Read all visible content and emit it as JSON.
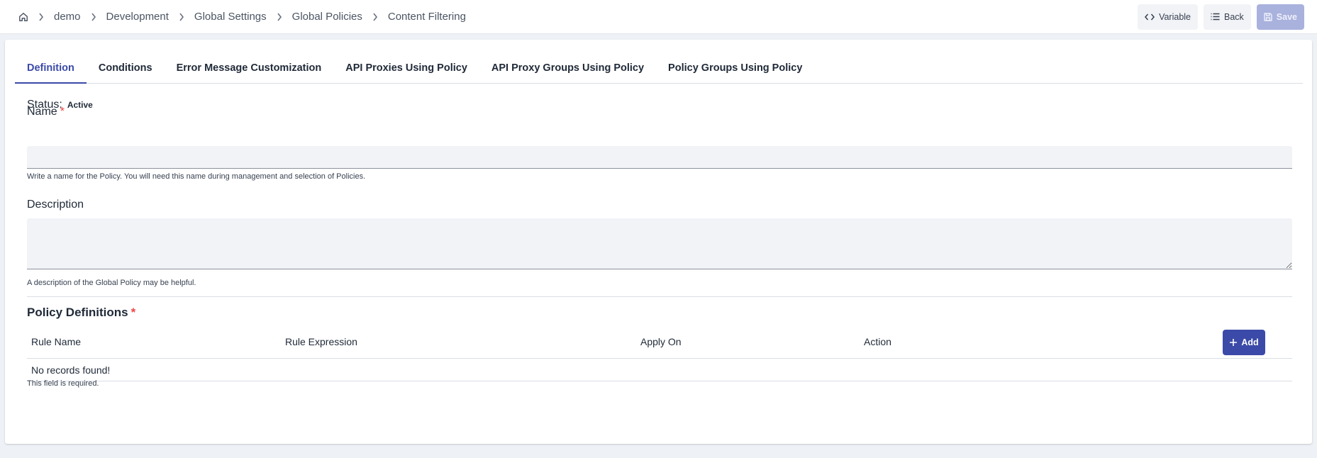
{
  "breadcrumb": {
    "items": [
      "demo",
      "Development",
      "Global Settings",
      "Global Policies",
      "Content Filtering"
    ]
  },
  "toolbar": {
    "variable_label": "Variable",
    "back_label": "Back",
    "save_label": "Save"
  },
  "tabs": [
    {
      "label": "Definition",
      "active": true
    },
    {
      "label": "Conditions"
    },
    {
      "label": "Error Message Customization"
    },
    {
      "label": "API Proxies Using Policy"
    },
    {
      "label": "API Proxy Groups Using Policy"
    },
    {
      "label": "Policy Groups Using Policy"
    }
  ],
  "form": {
    "status_label": "Status:",
    "status_value": "Active",
    "name_label": "Name",
    "name_value": "",
    "name_hint": "Write a name for the Policy. You will need this name during management and selection of Policies.",
    "description_label": "Description",
    "description_value": "",
    "description_hint": "A description of the Global Policy may be helpful.",
    "required_marker": "*"
  },
  "policy_definitions": {
    "title": "Policy Definitions",
    "columns": [
      "Rule Name",
      "Rule Expression",
      "Apply On",
      "Action"
    ],
    "add_label": "Add",
    "empty_text": "No records found!",
    "error_text": "This field is required."
  },
  "colors": {
    "accent": "#3b4aa8",
    "save_disabled": "#a9b1dd",
    "required": "#ef4444"
  }
}
